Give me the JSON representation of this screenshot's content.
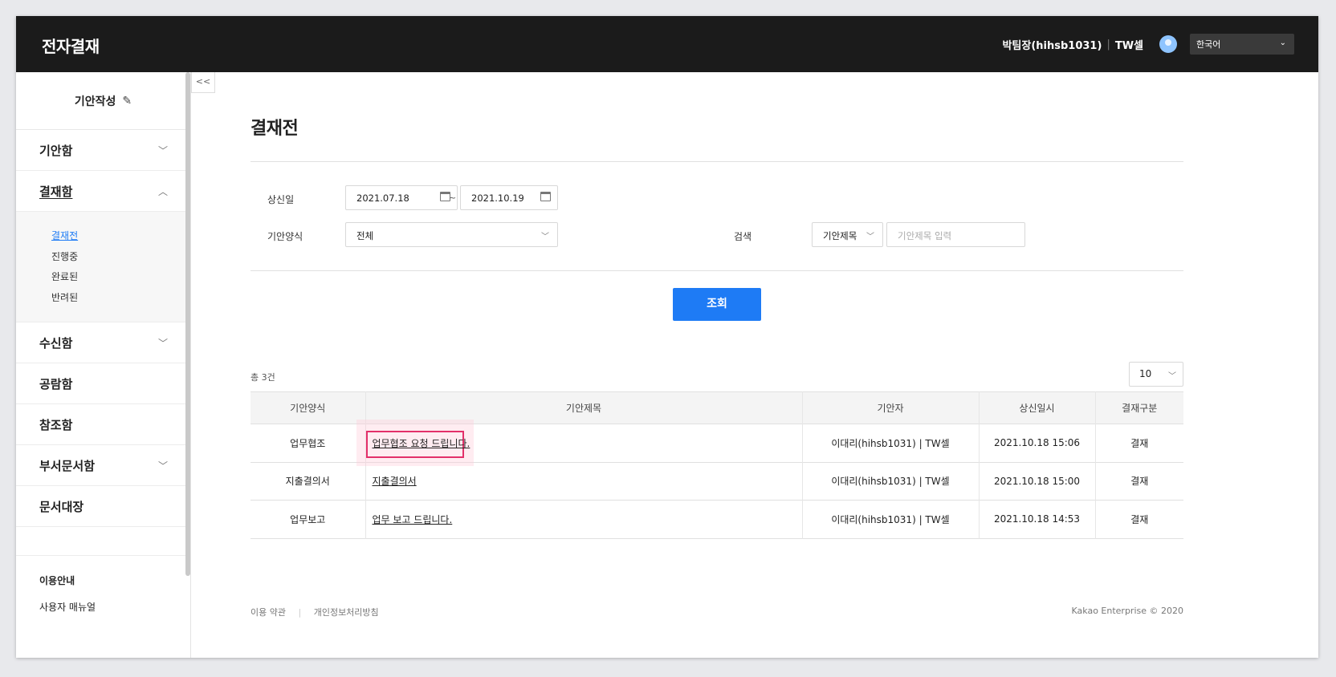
{
  "app": {
    "title": "전자결재"
  },
  "header": {
    "user_name": "박팀장(hihsb1031)",
    "team": "TW셀",
    "language": "한국어"
  },
  "sidebar": {
    "compose_label": "기안작성",
    "items": [
      {
        "label": "기안함"
      },
      {
        "label": "결재함"
      },
      {
        "label": "수신함"
      },
      {
        "label": "공람함"
      },
      {
        "label": "참조함"
      },
      {
        "label": "부서문서함"
      },
      {
        "label": "문서대장"
      }
    ],
    "sub_items": [
      "결재전",
      "진행중",
      "완료된",
      "반려된"
    ],
    "footer": [
      "이용안내",
      "사용자 매뉴얼"
    ]
  },
  "page": {
    "title": "결재전"
  },
  "filters": {
    "date_label": "상신일",
    "date_from": "2021.07.18",
    "date_sep": "~",
    "date_to": "2021.10.19",
    "form_label": "기안양식",
    "form_value": "전체",
    "search_label": "검색",
    "search_field": "기안제목",
    "search_placeholder": "기안제목 입력",
    "submit": "조회"
  },
  "results": {
    "total": "총 3건",
    "page_size": "10",
    "columns": [
      "기안양식",
      "기안제목",
      "기안자",
      "상신일시",
      "결재구분"
    ],
    "rows": [
      {
        "form": "업무협조",
        "title": "업무협조 요청 드립니다.",
        "author": "이대리(hihsb1031) | TW셀",
        "date": "2021.10.18 15:06",
        "type": "결재"
      },
      {
        "form": "지출결의서",
        "title": "지출결의서",
        "author": "이대리(hihsb1031) | TW셀",
        "date": "2021.10.18 15:00",
        "type": "결재"
      },
      {
        "form": "업무보고",
        "title": "업무 보고 드립니다.",
        "author": "이대리(hihsb1031) | TW셀",
        "date": "2021.10.18 14:53",
        "type": "결재"
      }
    ]
  },
  "footer": {
    "terms": "이용 약관",
    "privacy": "개인정보처리방침",
    "copyright": "Kakao Enterprise © 2020"
  },
  "colors": {
    "accent": "#1e7bf5",
    "header_bg": "#1b1b1b",
    "highlight": "#e3306a"
  }
}
